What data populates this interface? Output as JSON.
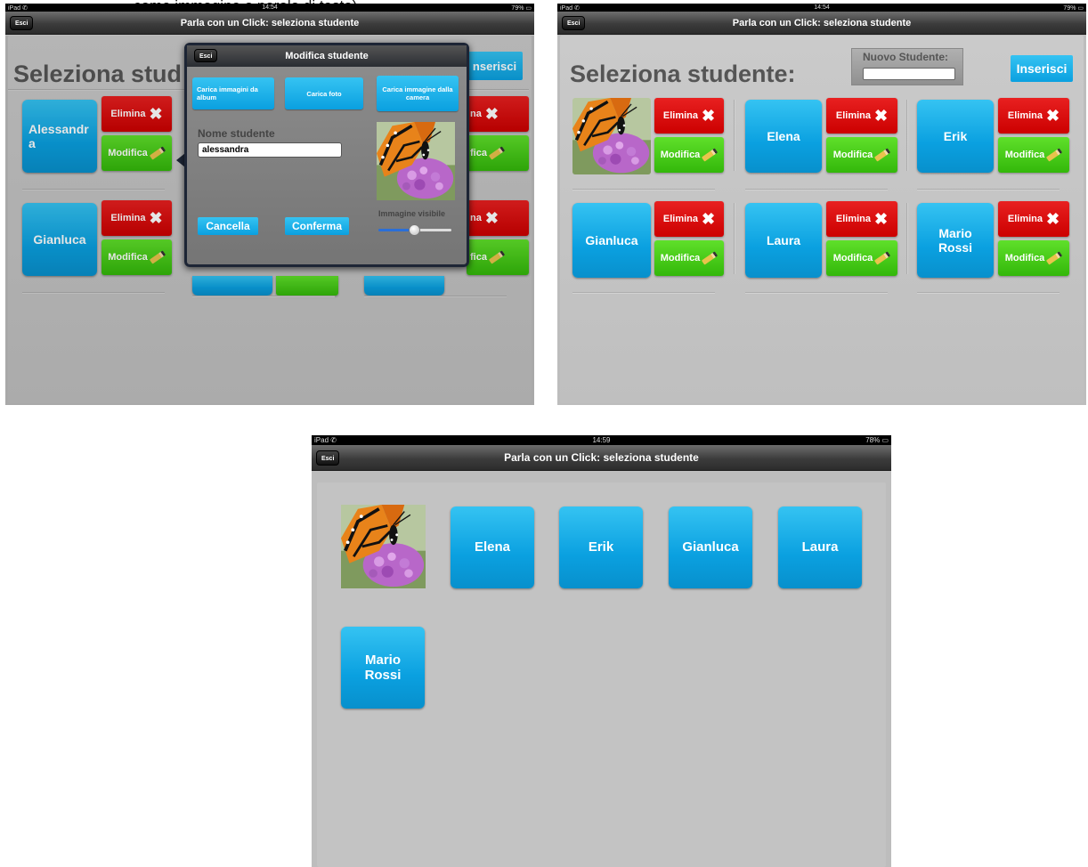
{
  "caption": "come immagine o parola di testo)",
  "colors": {
    "blue": "#0aa0e0",
    "red": "#d01010",
    "green": "#3cc313",
    "navbar": "#3c3c3c"
  },
  "shot1": {
    "status_left": "iPad ✆",
    "status_time": "14:54",
    "status_battery": "79% ▭",
    "nav_title": "Parla con un Click: seleziona studente",
    "esci": "Esci",
    "heading": "Seleziona stud",
    "inserisci_partial": "nserisci",
    "students": [
      {
        "name": "Alessandra"
      },
      {
        "name": "Gianluca"
      }
    ],
    "elimina": "Elimina",
    "elimina_partial": "na",
    "modifica": "Modifica",
    "modifica_partial": "fica",
    "modal": {
      "title": "Modifica studente",
      "esci": "Esci",
      "btn_album": "Carica immagini da album",
      "btn_foto": "Carica foto",
      "btn_camera": "Carica immagine dalla camera",
      "name_label": "Nome studente",
      "name_value": "alessandra",
      "image_label": "Immagine visibile",
      "slider_value": 0.5,
      "cancel": "Cancella",
      "confirm": "Conferma"
    }
  },
  "shot2": {
    "status_left": "iPad ✆",
    "status_time": "14:54",
    "status_battery": "79% ▭",
    "nav_title": "Parla con un Click: seleziona studente",
    "esci": "Esci",
    "heading": "Seleziona studente:",
    "nuovo_label": "Nuovo Studente:",
    "nuovo_value": "",
    "inserisci": "Inserisci",
    "elimina": "Elimina",
    "modifica": "Modifica",
    "students": [
      {
        "name": ""
      },
      {
        "name": "Elena"
      },
      {
        "name": "Erik"
      },
      {
        "name": "Gianluca"
      },
      {
        "name": "Laura"
      },
      {
        "name": "Mario Rossi"
      }
    ]
  },
  "shot3": {
    "status_left": "iPad ✆",
    "status_time": "14:59",
    "status_battery": "78% ▭",
    "nav_title": "Parla con un Click: seleziona studente",
    "esci": "Esci",
    "students": [
      {
        "name": ""
      },
      {
        "name": "Elena"
      },
      {
        "name": "Erik"
      },
      {
        "name": "Gianluca"
      },
      {
        "name": "Laura"
      },
      {
        "name": "Mario Rossi"
      }
    ]
  }
}
